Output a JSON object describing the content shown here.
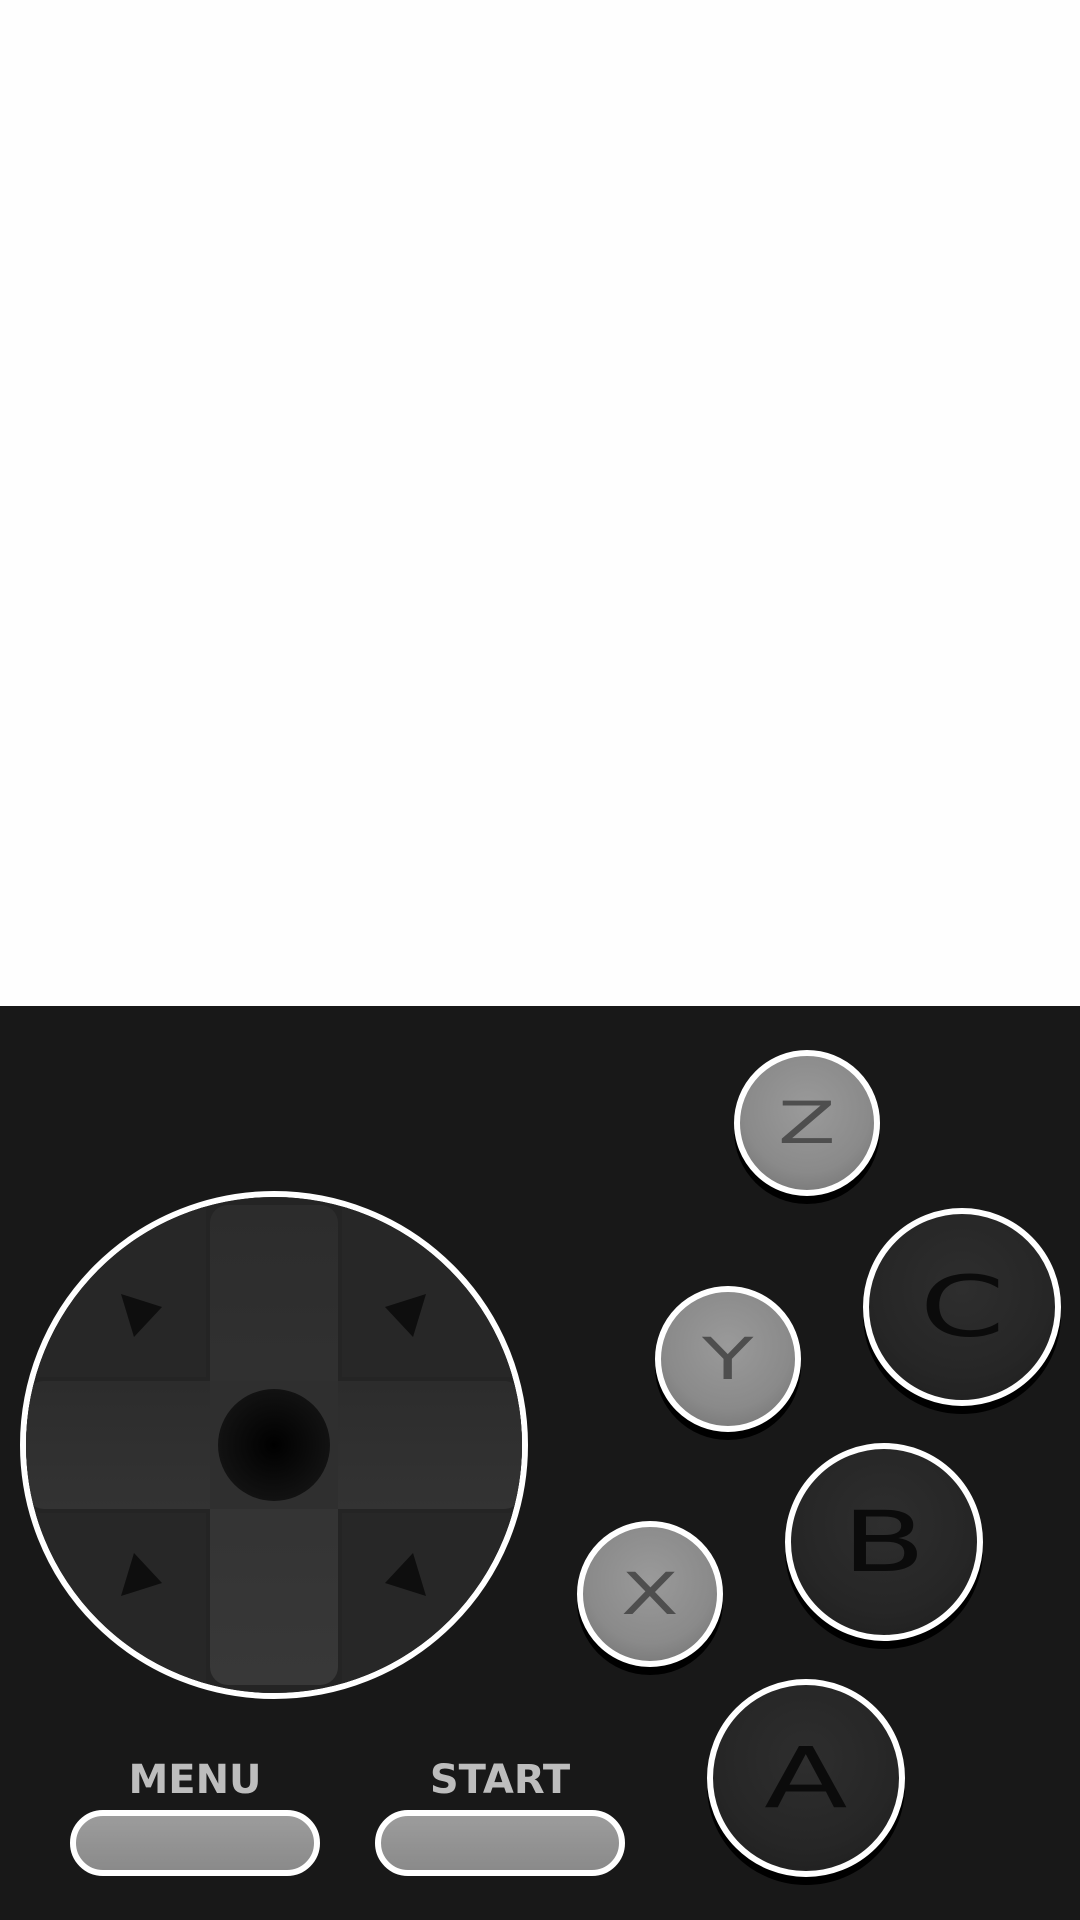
{
  "colors": {
    "screen_background": "#fefefe",
    "controller_background": "#181818",
    "button_outline": "#ffffff",
    "gray_button": "#8a8a8a",
    "dark_button": "#262626",
    "system_label": "#bdbdbd"
  },
  "dpad": {
    "icon": "directional-pad-icon",
    "directions": [
      "up",
      "down",
      "left",
      "right",
      "up-left",
      "up-right",
      "down-left",
      "down-right"
    ]
  },
  "buttons": {
    "z": "Z",
    "c": "C",
    "y": "Y",
    "b": "B",
    "x": "X",
    "a": "A"
  },
  "system": {
    "menu_label": "MENU",
    "start_label": "START"
  }
}
